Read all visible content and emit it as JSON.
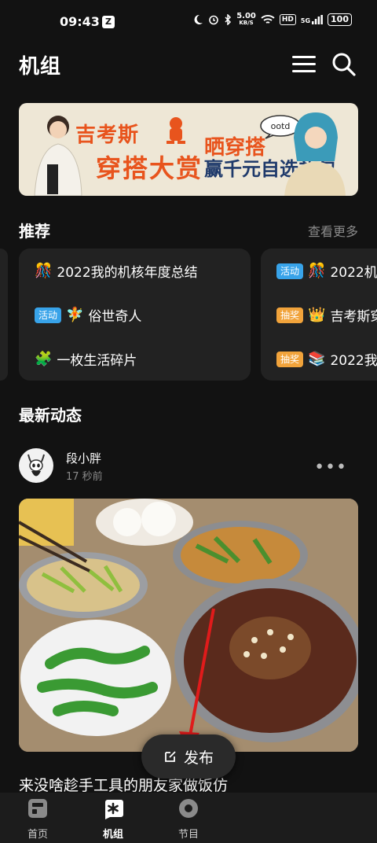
{
  "status_bar": {
    "time": "09:43",
    "z_badge": "Z",
    "net_speed": "5.00",
    "net_unit": "KB/S",
    "hd": "HD",
    "signal": "5G",
    "battery": "100"
  },
  "header": {
    "title": "机组"
  },
  "banner": {
    "line1": "吉考斯",
    "line2": "穿搭大赏",
    "line3": "晒穿搭",
    "line4": "赢千元自选礼包",
    "ootd": "ootd"
  },
  "recommend": {
    "title": "推荐",
    "more": "查看更多",
    "card1": [
      {
        "tag": "",
        "emoji": "🎊",
        "text": "2022我的机核年度总结"
      },
      {
        "tag": "活动",
        "emoji": "🧚",
        "text": "俗世奇人"
      },
      {
        "tag": "",
        "emoji": "🧩",
        "text": "一枚生活碎片"
      }
    ],
    "card2": [
      {
        "tag": "活动",
        "emoji": "🎊",
        "text": "2022机"
      },
      {
        "tag": "抽奖",
        "emoji": "👑",
        "text": "吉考斯穿"
      },
      {
        "tag": "抽奖",
        "emoji": "📚",
        "text": "2022我"
      }
    ]
  },
  "latest": {
    "title": "最新动态",
    "post": {
      "username": "段小胖",
      "time": "17 秒前",
      "text": "来没啥趁手工具的朋友家做饭仿"
    }
  },
  "publish": {
    "label": "发布"
  },
  "tabs": [
    {
      "label": "首页"
    },
    {
      "label": "机组"
    },
    {
      "label": "节目"
    }
  ],
  "colors": {
    "accent_orange": "#e8541d",
    "tag_blue": "#38a3e9",
    "tag_orange": "#f1a33b",
    "background": "#121212",
    "card": "#222222"
  }
}
